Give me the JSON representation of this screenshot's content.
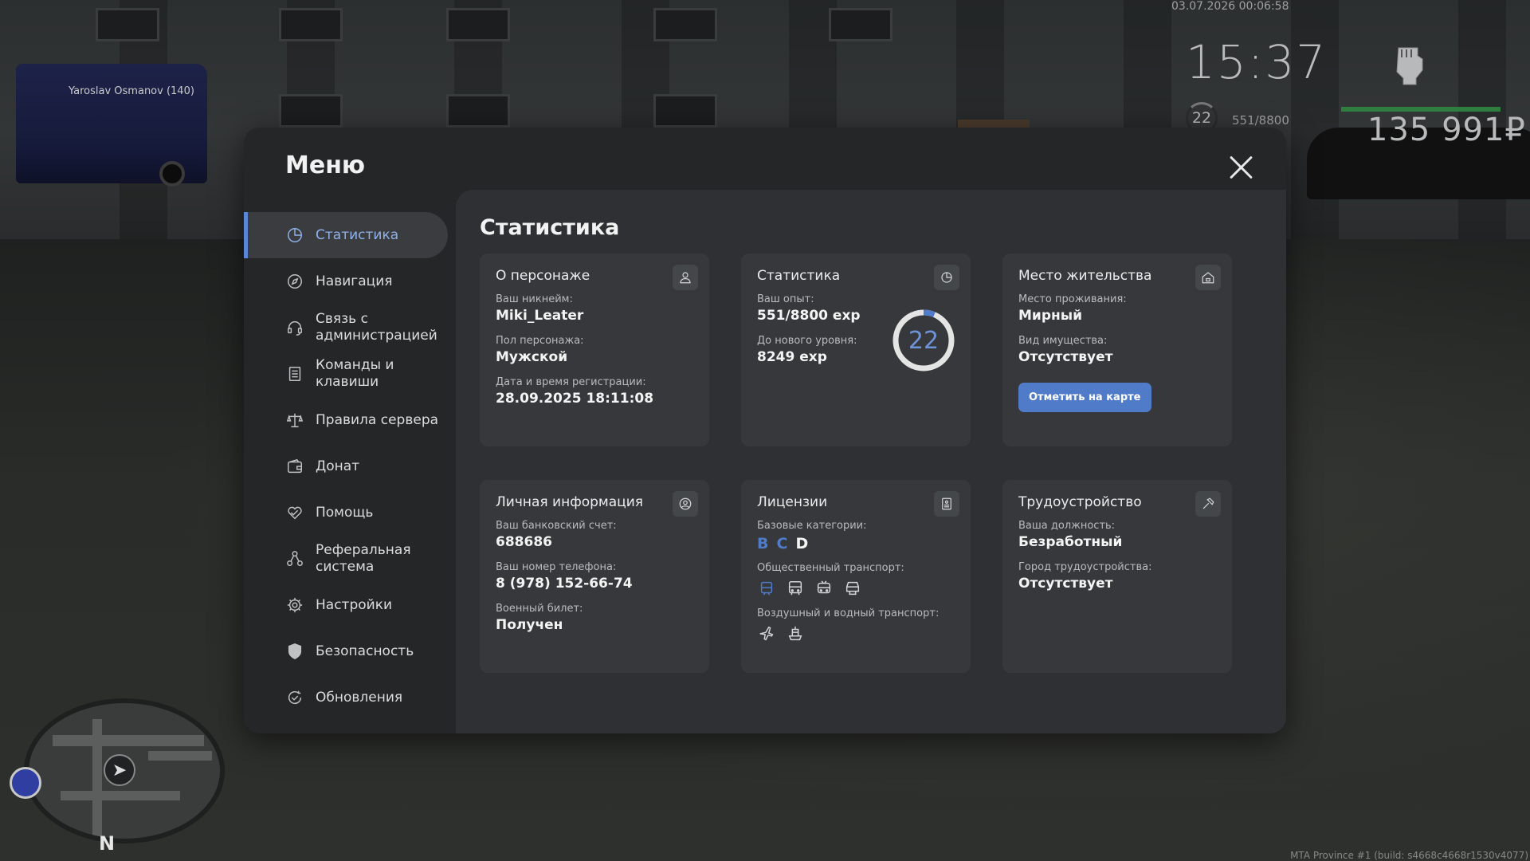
{
  "hud": {
    "date": "03.07.2026 00:06:58",
    "time": "15:37",
    "level": "22",
    "exp": "551/8800",
    "money": "135 991₽",
    "nametag": "Yaroslav Osmanov (140)",
    "build": "MTA Province #1 (build: s4668c4668r1530v4077)",
    "minimap_north": "N",
    "health_color": "#2f7d3f"
  },
  "menu": {
    "title": "Меню",
    "sidebar": [
      {
        "label": "Статистика",
        "icon": "pie-chart-icon",
        "active": true
      },
      {
        "label": "Навигация",
        "icon": "compass-icon",
        "active": false
      },
      {
        "label": "Связь с\nадминистрацией",
        "icon": "headset-icon",
        "active": false
      },
      {
        "label": "Команды и\nклавиши",
        "icon": "document-icon",
        "active": false
      },
      {
        "label": "Правила сервера",
        "icon": "scales-icon",
        "active": false
      },
      {
        "label": "Донат",
        "icon": "wallet-icon",
        "active": false
      },
      {
        "label": "Помощь",
        "icon": "heart-hand-icon",
        "active": false
      },
      {
        "label": "Реферальная\nсистема",
        "icon": "network-icon",
        "active": false
      },
      {
        "label": "Настройки",
        "icon": "gear-icon",
        "active": false
      },
      {
        "label": "Безопасность",
        "icon": "shield-icon",
        "active": false
      },
      {
        "label": "Обновления",
        "icon": "refresh-check-icon",
        "active": false
      }
    ],
    "accent_color": "#5a86d8"
  },
  "content": {
    "title": "Статистика",
    "character": {
      "title": "О персонаже",
      "nickname_label": "Ваш никнейм:",
      "nickname": "Miki_Leater",
      "gender_label": "Пол персонажа:",
      "gender": "Мужской",
      "reg_label": "Дата и время регистрации:",
      "reg_date": "28.09.2025 18:11:08"
    },
    "stats": {
      "title": "Статистика",
      "exp_label": "Ваш опыт:",
      "exp": "551/8800 exp",
      "next_label": "До нового уровня:",
      "next": "8249 exp",
      "level": "22",
      "progress": 0.0626
    },
    "residence": {
      "title": "Место жительства",
      "place_label": "Место проживания:",
      "place": "Мирный",
      "property_label": "Вид имущества:",
      "property": "Отсутствует",
      "button": "Отметить на карте"
    },
    "personal": {
      "title": "Личная информация",
      "bank_label": "Ваш банковский счет:",
      "bank": "688686",
      "phone_label": "Ваш номер телефона:",
      "phone": "8 (978) 152-66-74",
      "military_label": "Военный билет:",
      "military": "Получен"
    },
    "licenses": {
      "title": "Лицензии",
      "base_label": "Базовые категории:",
      "cat_b": "B",
      "cat_c": "C",
      "cat_d": "D",
      "public_label": "Общественный транспорт:",
      "air_label": "Воздушный и водный транспорт:"
    },
    "employment": {
      "title": "Трудоустройство",
      "position_label": "Ваша должность:",
      "position": "Безработный",
      "city_label": "Город трудоустройства:",
      "city": "Отсутствует"
    }
  }
}
